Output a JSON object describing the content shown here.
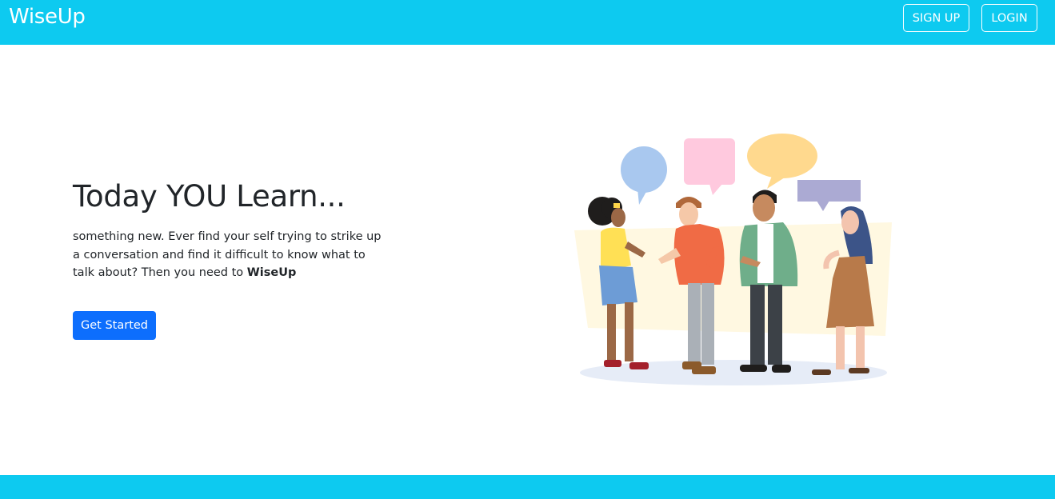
{
  "navbar": {
    "brand": "WiseUp",
    "signup_label": "SIGN UP",
    "login_label": "LOGIN"
  },
  "hero": {
    "title": "Today YOU Learn...",
    "text_before": "something new. Ever find your self trying to strike up a conversation and find it difficult to know what to talk about? Then you need to ",
    "text_bold": "WiseUp",
    "cta_label": "Get Started"
  },
  "colors": {
    "accent": "#0dcaf0",
    "primary_button": "#0d6efd"
  }
}
